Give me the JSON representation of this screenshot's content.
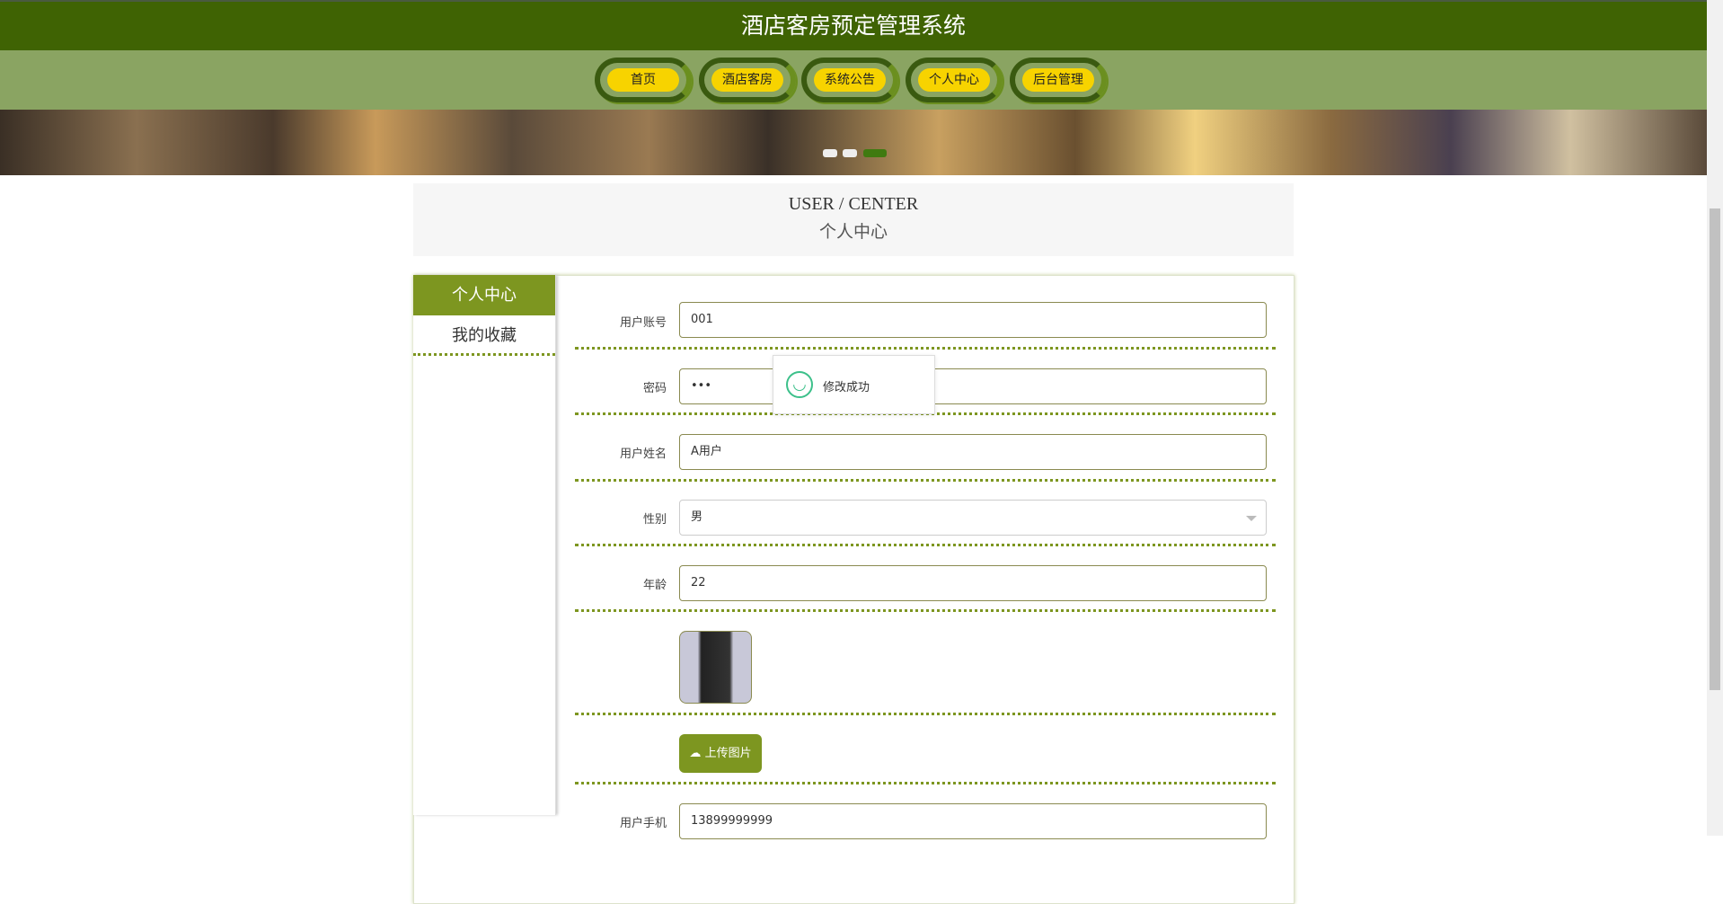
{
  "header": {
    "title": "酒店客房预定管理系统"
  },
  "nav": [
    {
      "label": "首页"
    },
    {
      "label": "酒店客房"
    },
    {
      "label": "系统公告"
    },
    {
      "label": "个人中心"
    },
    {
      "label": "后台管理"
    }
  ],
  "banner": {
    "slide_count": 3,
    "active_slide": 3
  },
  "section": {
    "title_en": "USER / CENTER",
    "title_cn": "个人中心"
  },
  "sidebar": [
    {
      "label": "个人中心"
    },
    {
      "label": "我的收藏"
    }
  ],
  "form": {
    "account": {
      "label": "用户账号",
      "value": "001"
    },
    "password": {
      "label": "密码",
      "value": "•••"
    },
    "name": {
      "label": "用户姓名",
      "value": "A用户"
    },
    "gender": {
      "label": "性别",
      "value": "男"
    },
    "age": {
      "label": "年龄",
      "value": "22"
    },
    "upload_label": "上传图片",
    "phone": {
      "label": "用户手机",
      "value": "13899999999"
    }
  },
  "toast": {
    "message": "修改成功"
  },
  "colors": {
    "header": "#3f6303",
    "nav": "#8aa462",
    "accent": "#7d9620",
    "nav_button": "#f7d300"
  }
}
